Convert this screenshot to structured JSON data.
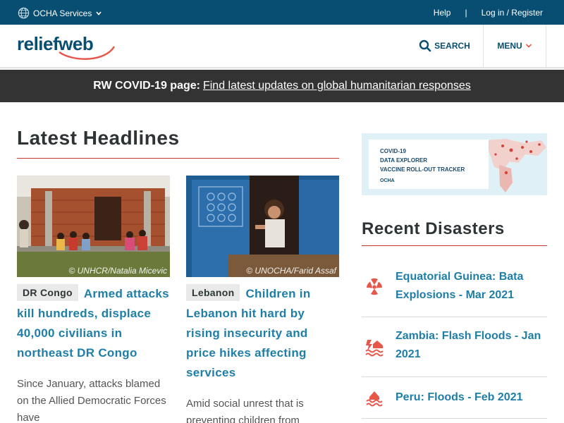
{
  "ocha_bar": {
    "services_label": "OCHA Services",
    "help_label": "Help",
    "separator": "|",
    "login_label": "Log in / Register"
  },
  "header": {
    "logo_text": "reliefweb",
    "search_label": "SEARCH",
    "menu_label": "MENU"
  },
  "banner": {
    "prefix": "RW COVID-19 page:",
    "link_text": "Find latest updates on global humanitarian responses"
  },
  "headlines": {
    "title": "Latest Headlines",
    "cards": [
      {
        "tag": "DR Congo",
        "title": "Armed attacks kill hundreds, displace 40,000 civilians in northeast DR Congo",
        "credit": "© UNHCR/Natalia Micevic",
        "body": "Since January, attacks blamed on the Allied Democratic Forces have"
      },
      {
        "tag": "Lebanon",
        "title": "Children in Lebanon hit hard by rising insecurity and price hikes affecting services",
        "credit": "© UNOCHA/Farid Assaf",
        "body": "Amid social unrest that is preventing children from"
      }
    ]
  },
  "ad": {
    "line1": "COVID-19",
    "line2": "DATA EXPLORER",
    "line3": "VACCINE ROLL-OUT TRACKER",
    "ocha": "OCHA"
  },
  "disasters": {
    "title": "Recent Disasters",
    "items": [
      {
        "label": "Equatorial Guinea: Bata Explosions - Mar 2021",
        "icon": "explosion-hazard-icon"
      },
      {
        "label": "Zambia: Flash Floods - Jan 2021",
        "icon": "flash-flood-icon"
      },
      {
        "label": "Peru: Floods - Feb 2021",
        "icon": "flood-icon"
      }
    ]
  },
  "colors": {
    "ocha_blue": "#084e72",
    "accent_red": "#c0392b",
    "link_blue": "#1f7ea8",
    "banner_dark": "#333333",
    "icon_red": "#e8564a"
  }
}
